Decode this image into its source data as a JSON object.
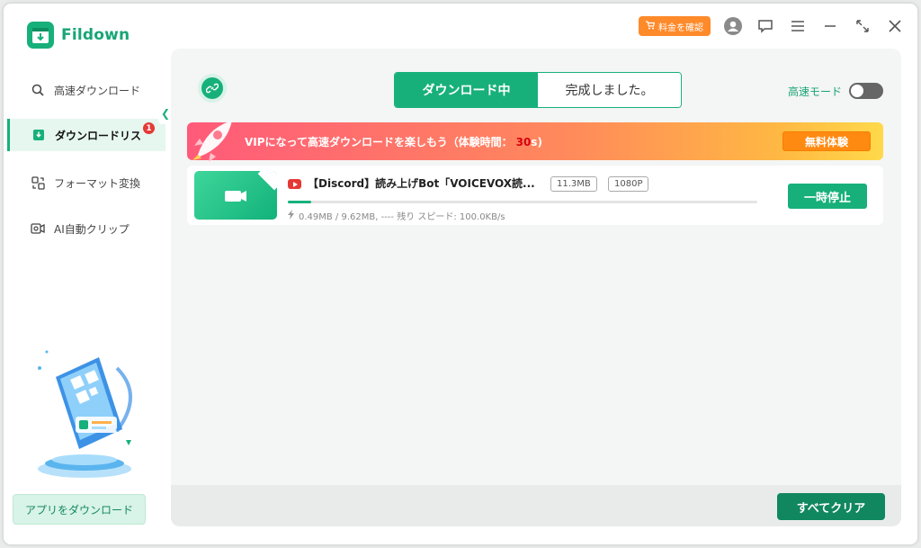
{
  "app": {
    "name": "Fildown"
  },
  "topbar": {
    "price_label": "料金を確認"
  },
  "sidebar": {
    "items": [
      {
        "label": "高速ダウンロード",
        "icon": "search-icon"
      },
      {
        "label": "ダウンロードリス",
        "icon": "download-list-icon",
        "badge": "1"
      },
      {
        "label": "フォーマット変換",
        "icon": "format-convert-icon"
      },
      {
        "label": "AI自動クリップ",
        "icon": "ai-clip-icon"
      }
    ],
    "app_download_label": "アプリをダウンロード"
  },
  "main": {
    "tabs": [
      {
        "label": "ダウンロード中",
        "active": true
      },
      {
        "label": "完成しました。",
        "active": false
      }
    ],
    "speed_mode_label": "高速モード",
    "speed_mode_on": false,
    "vip": {
      "text": "VIPになって高速ダウンロードを楽しもう（体験時間：",
      "countdown": "30",
      "suffix": "s)",
      "button_label": "無料体験"
    },
    "downloads": [
      {
        "source_icon": "youtube-icon",
        "title": "【Discord】読み上げBot「VOICEVOX読...",
        "size": "11.3MB",
        "quality": "1080P",
        "progress": 0.05,
        "stats": "0.49MB / 9.62MB, ---- 残り スピード: 100.0KB/s",
        "action_label": "一時停止"
      }
    ],
    "clear_all_label": "すべてクリア"
  },
  "colors": {
    "accent": "#17b07b",
    "price": "#ff8a2a",
    "badge": "#e53935"
  }
}
